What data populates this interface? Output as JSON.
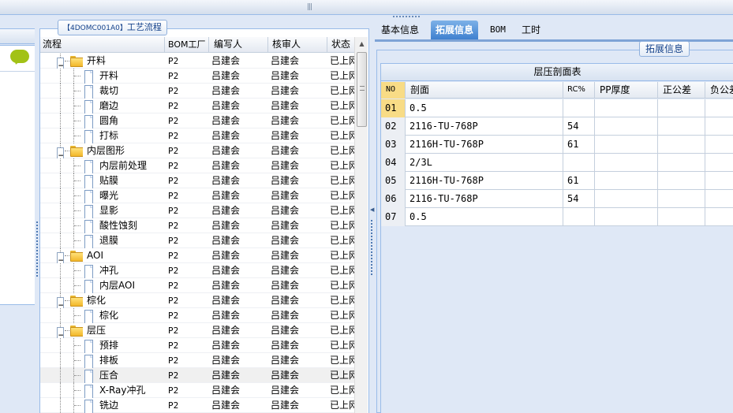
{
  "left_panel": {
    "title_code": "【4DOMC001A0】",
    "title_text": "工艺流程"
  },
  "tree_columns": [
    "流程",
    "BOM工厂",
    "编写人",
    "核审人",
    "状态"
  ],
  "tree_rows": [
    {
      "label": "开料",
      "type": "folder",
      "level": 1,
      "bom": "P2",
      "writer": "吕建会",
      "reviewer": "吕建会",
      "status": "已上网"
    },
    {
      "label": "开料",
      "type": "leaf",
      "level": 2,
      "bom": "P2",
      "writer": "吕建会",
      "reviewer": "吕建会",
      "status": "已上网"
    },
    {
      "label": "裁切",
      "type": "leaf",
      "level": 2,
      "bom": "P2",
      "writer": "吕建会",
      "reviewer": "吕建会",
      "status": "已上网"
    },
    {
      "label": "磨边",
      "type": "leaf",
      "level": 2,
      "bom": "P2",
      "writer": "吕建会",
      "reviewer": "吕建会",
      "status": "已上网"
    },
    {
      "label": "圆角",
      "type": "leaf",
      "level": 2,
      "bom": "P2",
      "writer": "吕建会",
      "reviewer": "吕建会",
      "status": "已上网"
    },
    {
      "label": "打标",
      "type": "leaf",
      "level": 2,
      "bom": "P2",
      "writer": "吕建会",
      "reviewer": "吕建会",
      "status": "已上网"
    },
    {
      "label": "内层图形",
      "type": "folder",
      "level": 1,
      "bom": "P2",
      "writer": "吕建会",
      "reviewer": "吕建会",
      "status": "已上网"
    },
    {
      "label": "内层前处理",
      "type": "leaf",
      "level": 2,
      "bom": "P2",
      "writer": "吕建会",
      "reviewer": "吕建会",
      "status": "已上网"
    },
    {
      "label": "贴膜",
      "type": "leaf",
      "level": 2,
      "bom": "P2",
      "writer": "吕建会",
      "reviewer": "吕建会",
      "status": "已上网"
    },
    {
      "label": "曝光",
      "type": "leaf",
      "level": 2,
      "bom": "P2",
      "writer": "吕建会",
      "reviewer": "吕建会",
      "status": "已上网"
    },
    {
      "label": "显影",
      "type": "leaf",
      "level": 2,
      "bom": "P2",
      "writer": "吕建会",
      "reviewer": "吕建会",
      "status": "已上网"
    },
    {
      "label": "酸性蚀刻",
      "type": "leaf",
      "level": 2,
      "bom": "P2",
      "writer": "吕建会",
      "reviewer": "吕建会",
      "status": "已上网"
    },
    {
      "label": "退膜",
      "type": "leaf",
      "level": 2,
      "bom": "P2",
      "writer": "吕建会",
      "reviewer": "吕建会",
      "status": "已上网"
    },
    {
      "label": "AOI",
      "type": "folder",
      "level": 1,
      "bom": "P2",
      "writer": "吕建会",
      "reviewer": "吕建会",
      "status": "已上网"
    },
    {
      "label": "冲孔",
      "type": "leaf",
      "level": 2,
      "bom": "P2",
      "writer": "吕建会",
      "reviewer": "吕建会",
      "status": "已上网"
    },
    {
      "label": "内层AOI",
      "type": "leaf",
      "level": 2,
      "bom": "P2",
      "writer": "吕建会",
      "reviewer": "吕建会",
      "status": "已上网"
    },
    {
      "label": "棕化",
      "type": "folder",
      "level": 1,
      "bom": "P2",
      "writer": "吕建会",
      "reviewer": "吕建会",
      "status": "已上网"
    },
    {
      "label": "棕化",
      "type": "leaf",
      "level": 2,
      "bom": "P2",
      "writer": "吕建会",
      "reviewer": "吕建会",
      "status": "已上网"
    },
    {
      "label": "层压",
      "type": "folder",
      "level": 1,
      "bom": "P2",
      "writer": "吕建会",
      "reviewer": "吕建会",
      "status": "已上网"
    },
    {
      "label": "预排",
      "type": "leaf",
      "level": 2,
      "bom": "P2",
      "writer": "吕建会",
      "reviewer": "吕建会",
      "status": "已上网"
    },
    {
      "label": "排板",
      "type": "leaf",
      "level": 2,
      "bom": "P2",
      "writer": "吕建会",
      "reviewer": "吕建会",
      "status": "已上网"
    },
    {
      "label": "压合",
      "type": "leaf",
      "level": 2,
      "bom": "P2",
      "writer": "吕建会",
      "reviewer": "吕建会",
      "status": "已上网",
      "selected": true
    },
    {
      "label": "X-Ray冲孔",
      "type": "leaf",
      "level": 2,
      "bom": "P2",
      "writer": "吕建会",
      "reviewer": "吕建会",
      "status": "已上网"
    },
    {
      "label": "铣边",
      "type": "leaf",
      "level": 2,
      "bom": "P2",
      "writer": "吕建会",
      "reviewer": "吕建会",
      "status": "已上网"
    }
  ],
  "right_panel": {
    "tabs": [
      "基本信息",
      "拓展信息",
      "BOM",
      "工时"
    ],
    "active_tab": 1,
    "section_title": "拓展信息",
    "table_title": "层压剖面表",
    "columns": [
      "NO",
      "剖面",
      "RC%",
      "PP厚度",
      "正公差",
      "负公差"
    ],
    "rows": [
      {
        "no": "01",
        "profile": "0.5",
        "rc": "",
        "pp": "",
        "plus": "",
        "minus": ""
      },
      {
        "no": "02",
        "profile": "2116-TU-768P",
        "rc": "54",
        "pp": "",
        "plus": "",
        "minus": ""
      },
      {
        "no": "03",
        "profile": "2116H-TU-768P",
        "rc": "61",
        "pp": "",
        "plus": "",
        "minus": ""
      },
      {
        "no": "04",
        "profile": "2/3L",
        "rc": "",
        "pp": "",
        "plus": "",
        "minus": ""
      },
      {
        "no": "05",
        "profile": "2116H-TU-768P",
        "rc": "61",
        "pp": "",
        "plus": "",
        "minus": ""
      },
      {
        "no": "06",
        "profile": "2116-TU-768P",
        "rc": "54",
        "pp": "",
        "plus": "",
        "minus": ""
      },
      {
        "no": "07",
        "profile": "0.5",
        "rc": "",
        "pp": "",
        "plus": "",
        "minus": ""
      }
    ]
  },
  "colors": {
    "background": "#dfe8f6",
    "border": "#99bbe8",
    "active_tab": "#3e80cf",
    "highlight_cell": "#f8dc86",
    "folder": "#f2b72a",
    "chat_bubble": "#a2c216"
  },
  "icons": {
    "chat": "chat-bubble-icon",
    "folder": "folder-icon",
    "document": "document-icon",
    "expander": "collapse-icon"
  }
}
